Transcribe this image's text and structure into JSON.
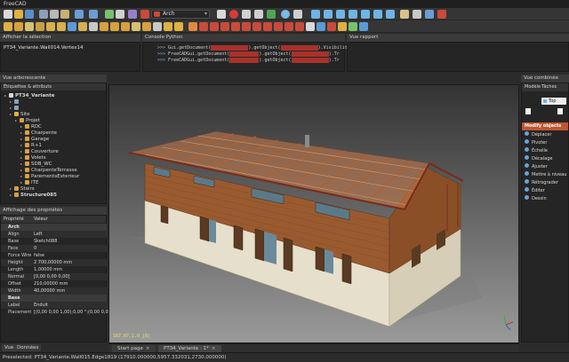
{
  "app": {
    "title": "FreeCAD"
  },
  "toolbar": {
    "workbench": "Arch"
  },
  "panels": {
    "selection": {
      "title": "Afficher la sélection",
      "text": "PT34_Variante.Wall014.Vertex14"
    },
    "console": {
      "title": "Console Python",
      "lines": [
        {
          "prompt": ">>> ",
          "a": "Gui.getDocument(",
          "b": ").getObject(",
          "c": ").Visibility"
        },
        {
          "prompt": ">>> ",
          "a": "FreeCADGui.getDocument(",
          "b": ").getObject(",
          "c": ").Tr"
        },
        {
          "prompt": ">>> ",
          "a": "FreeCADGui.getDocument(",
          "b": ").getObject(",
          "c": ").Tr"
        }
      ]
    },
    "report": {
      "title": "Vue rapport"
    },
    "tree": {
      "title": "Vue arborescente",
      "header": "Étiquettes & attributs",
      "items": [
        {
          "label": "PT34_Variante",
          "bold": true
        },
        {
          "label": ""
        },
        {
          "label": ""
        },
        {
          "label": "Site"
        },
        {
          "label": "Projet"
        },
        {
          "label": "RDC"
        },
        {
          "label": "Charpente"
        },
        {
          "label": "Garage"
        },
        {
          "label": "R+1"
        },
        {
          "label": "Couverture"
        },
        {
          "label": "Volets"
        },
        {
          "label": "SDB_WC"
        },
        {
          "label": "CharpenteTerrasse"
        },
        {
          "label": "ParementsExterieur"
        },
        {
          "label": "ITE"
        },
        {
          "label": "Stairs"
        },
        {
          "label": "Structure085",
          "bold": true
        }
      ]
    },
    "properties": {
      "title": "Affichage des propriétés",
      "col_prop": "Propriété",
      "col_value": "Valeur",
      "rows": [
        {
          "k": "Arch",
          "v": "",
          "group": true
        },
        {
          "k": "Align",
          "v": "Left"
        },
        {
          "k": "Base",
          "v": "Sketch088"
        },
        {
          "k": "Face",
          "v": "0"
        },
        {
          "k": "Force Wire",
          "v": "false"
        },
        {
          "k": "Height",
          "v": "2 700,00000 mm"
        },
        {
          "k": "Length",
          "v": "1,00000 mm"
        },
        {
          "k": "Normal",
          "v": "[0,00 0,00 0,00]"
        },
        {
          "k": "Offset",
          "v": "210,00000 mm"
        },
        {
          "k": "Width",
          "v": "40,00000 mm"
        },
        {
          "k": "Base",
          "v": "",
          "group": true
        },
        {
          "k": "Label",
          "v": "Enduit"
        },
        {
          "k": "Placement",
          "v": "[(0,00 0,00 1,00);0,00 °;(0,00 0,00 0,00)]"
        }
      ],
      "tabs": [
        "Vue",
        "Données"
      ]
    },
    "combo": {
      "title": "Vue combinée",
      "tabs": [
        "Modèle",
        "Tâches"
      ],
      "top_label": "Top",
      "section": "Modify objects",
      "items": [
        "Déplacer",
        "Pivoter",
        "Échelle",
        "Décalage",
        "Ajuster",
        "Mettre à niveau",
        "Rétrograder",
        "Éditer",
        "Dessin"
      ]
    }
  },
  "viewport": {
    "coord_readout": "167.07.1.0 [0]",
    "tabs": [
      {
        "label": "Start page"
      },
      {
        "label": "PT34_Variante : 1*"
      }
    ]
  },
  "status": {
    "text": "Preselected: PT34_Variante.Wall015.Edge1819 (17910.000000,5957.332031,2730.000000)"
  },
  "colors": {
    "accent": "#c94a3a",
    "panel_bg": "#252525",
    "selection_hl": "#a8322b"
  }
}
